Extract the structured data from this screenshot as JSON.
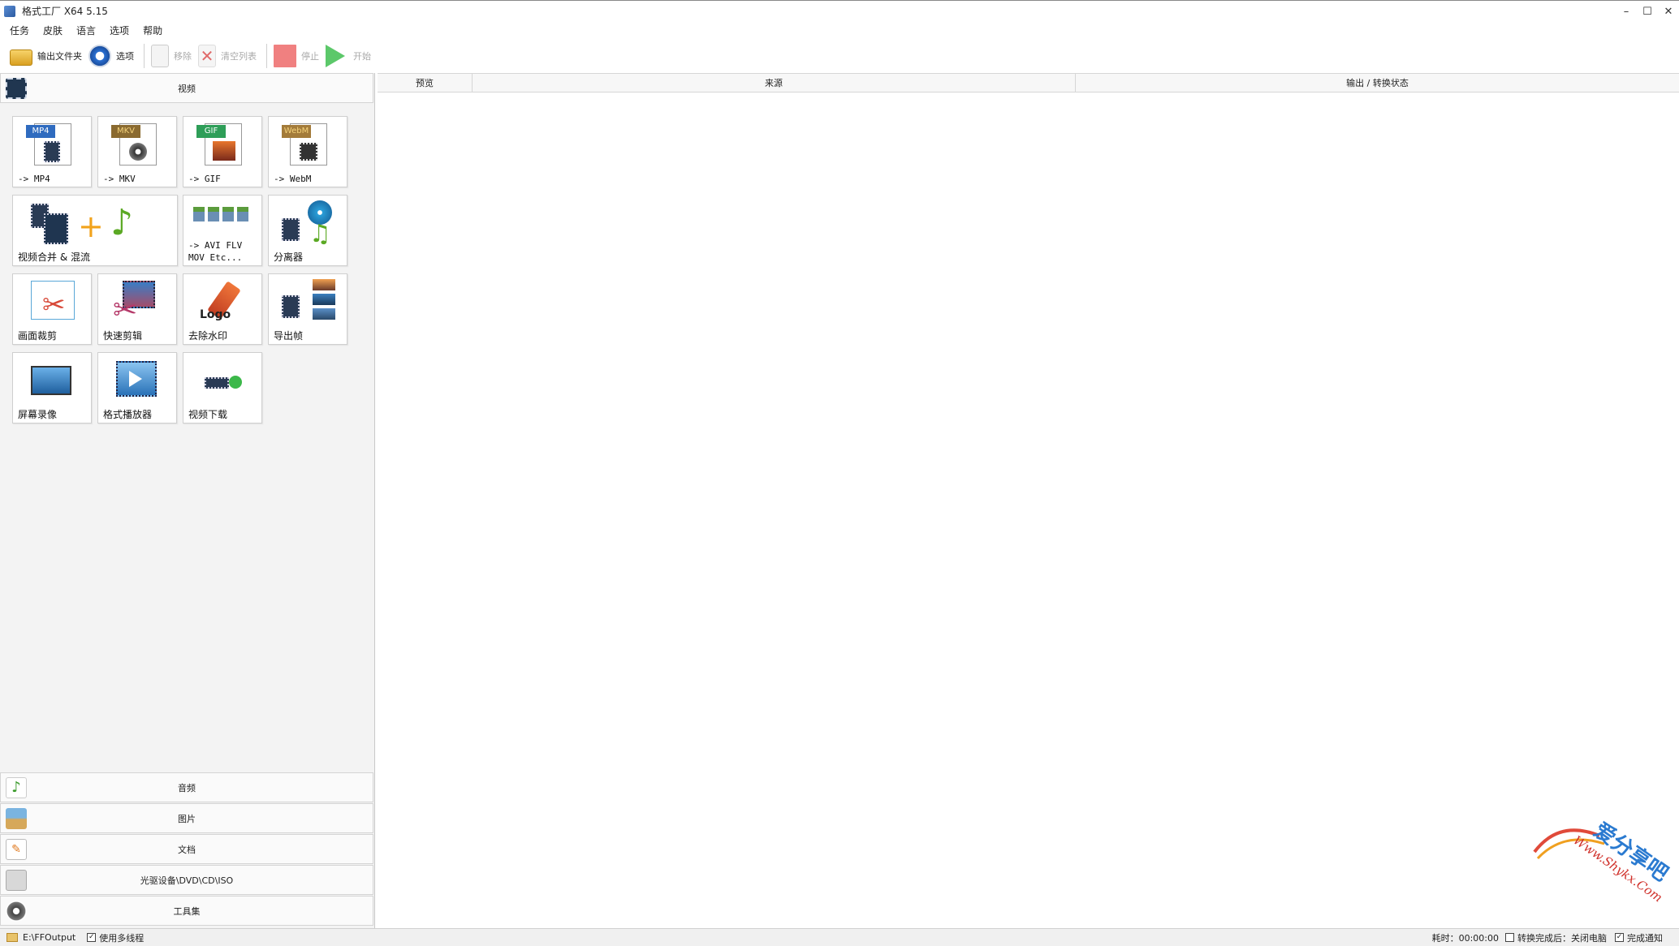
{
  "window": {
    "title": "格式工厂 X64 5.15"
  },
  "menu": [
    "任务",
    "皮肤",
    "语言",
    "选项",
    "帮助"
  ],
  "toolbar": {
    "output_folder": "输出文件夹",
    "options": "选项",
    "remove": "移除",
    "clear_list": "清空列表",
    "stop": "停止",
    "start": "开始"
  },
  "categories": {
    "video": "视频",
    "audio": "音频",
    "image": "图片",
    "document": "文档",
    "optical": "光驱设备\\DVD\\CD\\ISO",
    "tools": "工具集"
  },
  "video_tiles": {
    "mp4": "-> MP4",
    "mkv": "-> MKV",
    "gif": "-> GIF",
    "webm": "-> WebM",
    "merge": "视频合并 & 混流",
    "avi": "-> AVI FLV\nMOV Etc...",
    "splitter": "分离器",
    "crop": "画面裁剪",
    "quick_edit": "快速剪辑",
    "remove_watermark": "去除水印",
    "export_frames": "导出帧",
    "screen_record": "屏幕录像",
    "player": "格式播放器",
    "download": "视频下载"
  },
  "badges": {
    "mp4": "MP4",
    "mkv": "MKV",
    "gif": "GIF",
    "webm": "WebM",
    "logo": "Logo"
  },
  "columns": {
    "preview": "预览",
    "source": "来源",
    "output_status": "输出 / 转换状态"
  },
  "status": {
    "output_path": "E:\\FFOutput",
    "multithread": "使用多线程",
    "elapsed": "耗时：00:00:00",
    "after_convert": "转换完成后：关闭电脑",
    "notify": "完成通知"
  },
  "watermark": {
    "text1": "爱分享吧",
    "text2": "Www.Shykx.Com"
  },
  "colors": {
    "mp4_badge": "#2f6bbf",
    "mkv_badge": "#8a6a30",
    "gif_badge": "#2e9e58",
    "webm_badge": "#a37b3a",
    "stop": "#f08080",
    "start": "#3cb84a"
  }
}
